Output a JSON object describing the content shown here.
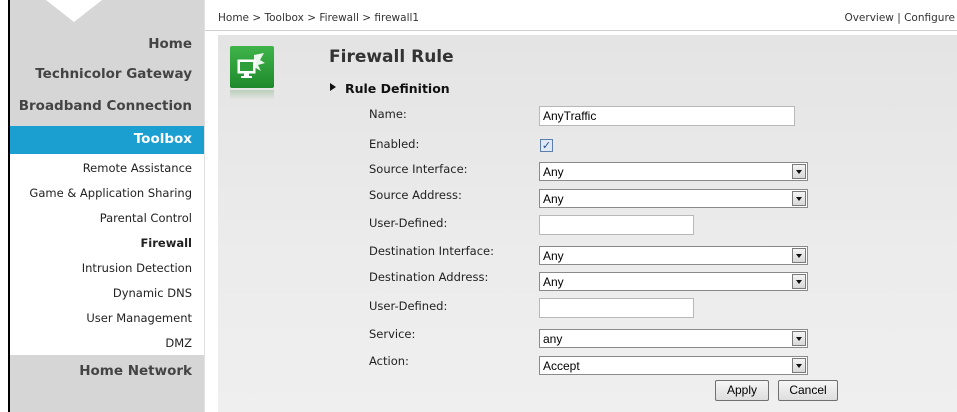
{
  "sidebar": {
    "major": [
      "Home",
      "Technicolor Gateway",
      "Broadband Connection"
    ],
    "toolbox_label": "Toolbox",
    "sub": [
      "Remote Assistance",
      "Game & Application Sharing",
      "Parental Control",
      "Firewall",
      "Intrusion Detection",
      "Dynamic DNS",
      "User Management",
      "DMZ"
    ],
    "active_sub": "Firewall",
    "home_network": "Home Network"
  },
  "breadcrumb": "Home > Toolbox > Firewall > firewall1",
  "top_links": "Overview | Configure",
  "page": {
    "title": "Firewall Rule",
    "section": "Rule Definition"
  },
  "form": {
    "name_label": "Name:",
    "name_value": "AnyTraffic",
    "enabled_label": "Enabled:",
    "enabled_checked": true,
    "enabled_mark": "✓",
    "source_interface_label": "Source Interface:",
    "source_interface_value": "Any",
    "source_address_label": "Source Address:",
    "source_address_value": "Any",
    "user_defined_label_1": "User-Defined:",
    "user_defined_value_1": "",
    "destination_interface_label": "Destination Interface:",
    "destination_interface_value": "Any",
    "destination_address_label": "Destination Address:",
    "destination_address_value": "Any",
    "user_defined_label_2": "User-Defined:",
    "user_defined_value_2": "",
    "service_label": "Service:",
    "service_value": "any",
    "action_label": "Action:",
    "action_value": "Accept"
  },
  "buttons": {
    "apply": "Apply",
    "cancel": "Cancel"
  },
  "colors": {
    "toolbox_accent": "#1a9fd0",
    "sidebar_gray": "#d6d6d6",
    "logo_green": "#2e9e3a"
  },
  "icons": {
    "page_logo": "firewall-monitor-icon",
    "section_bullet": "triangle-right-icon",
    "dropdown": "chevron-down-icon"
  }
}
